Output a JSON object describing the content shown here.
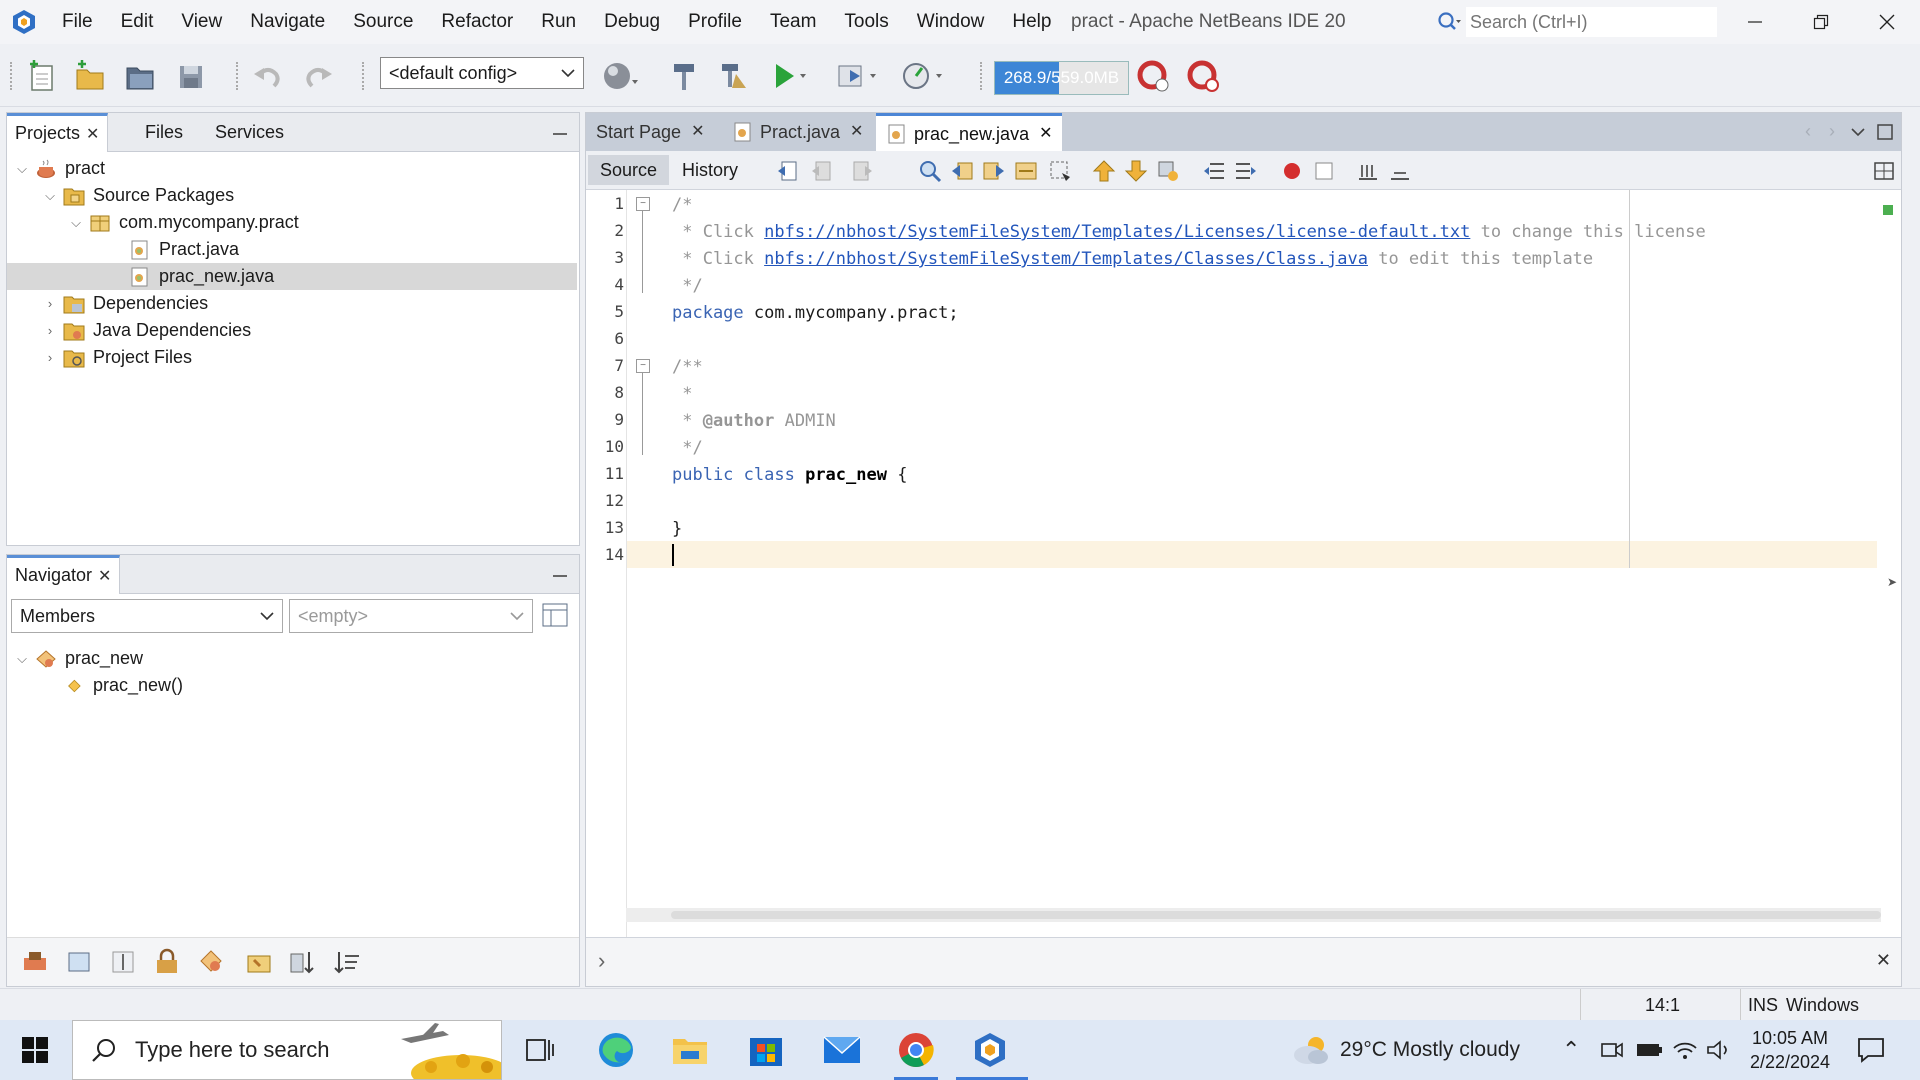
{
  "window": {
    "title": "pract - Apache NetBeans IDE 20",
    "search_placeholder": "Search (Ctrl+I)"
  },
  "menu": [
    "File",
    "Edit",
    "View",
    "Navigate",
    "Source",
    "Refactor",
    "Run",
    "Debug",
    "Profile",
    "Team",
    "Tools",
    "Window",
    "Help"
  ],
  "toolbar": {
    "config": "<default config>",
    "memory_text": "268.9/559.0MB",
    "memory_fraction": 0.48
  },
  "projects_panel": {
    "tabs": [
      "Projects",
      "Files",
      "Services"
    ],
    "tree": {
      "project": "pract",
      "source_packages": "Source Packages",
      "package": "com.mycompany.pract",
      "file1": "Pract.java",
      "file2": "prac_new.java",
      "dependencies": "Dependencies",
      "java_dependencies": "Java Dependencies",
      "project_files": "Project Files"
    }
  },
  "navigator": {
    "title": "Navigator",
    "filter": "Members",
    "second_filter": "<empty>",
    "class_name": "prac_new",
    "constructor": "prac_new()"
  },
  "editor": {
    "tabs": [
      "Start Page",
      "Pract.java",
      "prac_new.java"
    ],
    "active_tab": "prac_new.java",
    "source_tab": "Source",
    "history_tab": "History",
    "line_numbers": [
      "1",
      "2",
      "3",
      "4",
      "5",
      "6",
      "7",
      "8",
      "9",
      "10",
      "11",
      "12",
      "13",
      "14"
    ],
    "code": {
      "l1": "/*",
      "l2_pre": " * Click ",
      "l2_link": "nbfs://nbhost/SystemFileSystem/Templates/Licenses/license-default.txt",
      "l2_post": " to change this license",
      "l3_pre": " * Click ",
      "l3_link": "nbfs://nbhost/SystemFileSystem/Templates/Classes/Class.java",
      "l3_post": " to edit this template",
      "l4": " */",
      "l5_kw": "package",
      "l5_rest": " com.mycompany.pract;",
      "l7": "/**",
      "l8": " *",
      "l9_pre": " * ",
      "l9_tag": "@author",
      "l9_post": " ADMIN",
      "l10": " */",
      "l11_kw": "public class",
      "l11_name": "prac_new",
      "l11_rest": " {",
      "l13": "}"
    }
  },
  "status": {
    "position": "14:1",
    "mode": "INS",
    "line_endings": "Windows (CRLF)"
  },
  "taskbar": {
    "search_placeholder": "Type here to search",
    "weather": "29°C  Mostly cloudy",
    "time": "10:05 AM",
    "date": "2/22/2024"
  },
  "colors": {
    "accent": "#3d86d6",
    "keyword": "#3a64b3",
    "comment": "#969696",
    "link": "#2255bb",
    "current_line": "#fcf3e1"
  }
}
